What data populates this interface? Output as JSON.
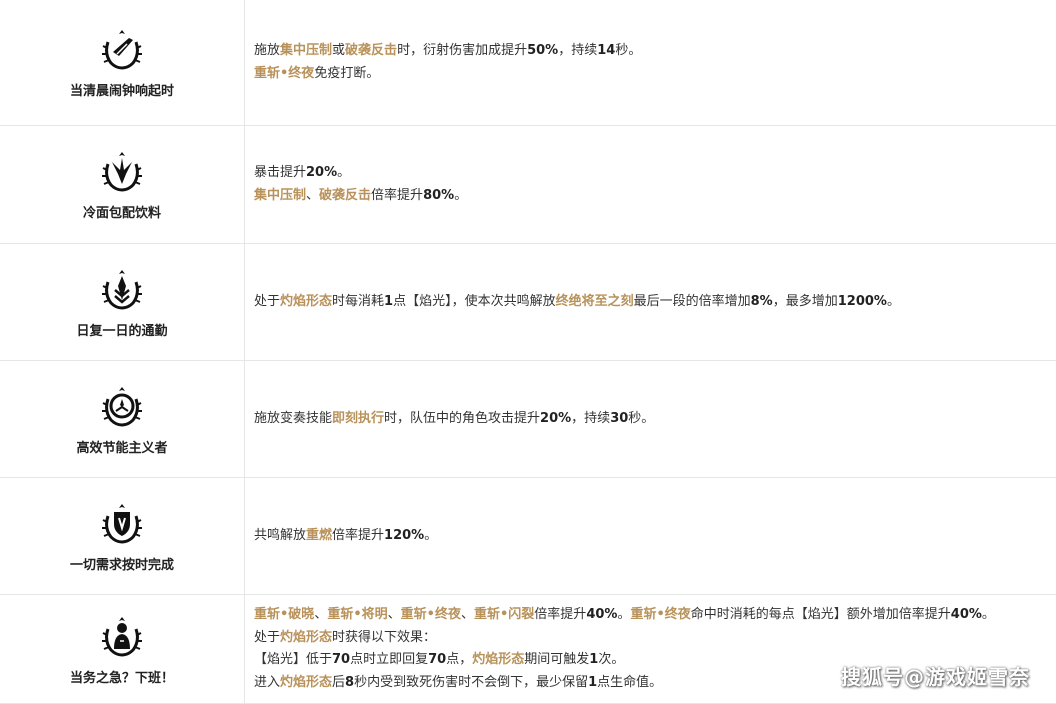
{
  "rows": [
    {
      "name": "当清晨闹钟响起时",
      "lines": [
        [
          [
            "t",
            "施放"
          ],
          [
            "k",
            "集中压制"
          ],
          [
            "t",
            "或"
          ],
          [
            "k",
            "破袭反击"
          ],
          [
            "t",
            "时，衍射伤害加成提升"
          ],
          [
            "n",
            "50%"
          ],
          [
            "t",
            "，持续"
          ],
          [
            "n",
            "14"
          ],
          [
            "t",
            "秒。"
          ]
        ],
        [
          [
            "k",
            "重斩•终夜"
          ],
          [
            "t",
            "免疫打断。"
          ]
        ]
      ]
    },
    {
      "name": "冷面包配饮料",
      "lines": [
        [
          [
            "t",
            "暴击提升"
          ],
          [
            "n",
            "20%"
          ],
          [
            "t",
            "。"
          ]
        ],
        [
          [
            "k",
            "集中压制"
          ],
          [
            "t",
            "、"
          ],
          [
            "k",
            "破袭反击"
          ],
          [
            "t",
            "倍率提升"
          ],
          [
            "n",
            "80%"
          ],
          [
            "t",
            "。"
          ]
        ]
      ]
    },
    {
      "name": "日复一日的通勤",
      "lines": [
        [
          [
            "t",
            "处于"
          ],
          [
            "k",
            "灼焰形态"
          ],
          [
            "t",
            "时每消耗"
          ],
          [
            "n",
            "1"
          ],
          [
            "t",
            "点【焰光】，使本次共鸣解放"
          ],
          [
            "k",
            "终绝将至之刻"
          ],
          [
            "t",
            "最后一段的倍率增加"
          ],
          [
            "n",
            "8%"
          ],
          [
            "t",
            "，最多增加"
          ],
          [
            "n",
            "1200%"
          ],
          [
            "t",
            "。"
          ]
        ]
      ]
    },
    {
      "name": "高效节能主义者",
      "lines": [
        [
          [
            "t",
            "施放变奏技能"
          ],
          [
            "k",
            "即刻执行"
          ],
          [
            "t",
            "时，队伍中的角色攻击提升"
          ],
          [
            "n",
            "20%"
          ],
          [
            "t",
            "，持续"
          ],
          [
            "n",
            "30"
          ],
          [
            "t",
            "秒。"
          ]
        ]
      ]
    },
    {
      "name": "一切需求按时完成",
      "lines": [
        [
          [
            "t",
            "共鸣解放"
          ],
          [
            "k",
            "重燃"
          ],
          [
            "t",
            "倍率提升"
          ],
          [
            "n",
            "120%"
          ],
          [
            "t",
            "。"
          ]
        ]
      ]
    },
    {
      "name": "当务之急？下班！",
      "lines": [
        [
          [
            "k",
            "重斩•破晓"
          ],
          [
            "t",
            "、"
          ],
          [
            "k",
            "重斩•将明"
          ],
          [
            "t",
            "、"
          ],
          [
            "k",
            "重斩•终夜"
          ],
          [
            "t",
            "、"
          ],
          [
            "k",
            "重斩•闪裂"
          ],
          [
            "t",
            "倍率提升"
          ],
          [
            "n",
            "40%"
          ],
          [
            "t",
            "。"
          ],
          [
            "k",
            "重斩•终夜"
          ],
          [
            "t",
            "命中时消耗的每点【焰光】额外增加倍率提升"
          ],
          [
            "n",
            "40%"
          ],
          [
            "t",
            "。"
          ]
        ],
        [
          [
            "t",
            "处于"
          ],
          [
            "k",
            "灼焰形态"
          ],
          [
            "t",
            "时获得以下效果："
          ]
        ],
        [
          [
            "t",
            "【焰光】低于"
          ],
          [
            "n",
            "70"
          ],
          [
            "t",
            "点时立即回复"
          ],
          [
            "n",
            "70"
          ],
          [
            "t",
            "点，"
          ],
          [
            "k",
            "灼焰形态"
          ],
          [
            "t",
            "期间可触发"
          ],
          [
            "n",
            "1"
          ],
          [
            "t",
            "次。"
          ]
        ],
        [
          [
            "t",
            "进入"
          ],
          [
            "k",
            "灼焰形态"
          ],
          [
            "t",
            "后"
          ],
          [
            "n",
            "8"
          ],
          [
            "t",
            "秒内受到致死伤害时不会倒下，最少保留"
          ],
          [
            "n",
            "1"
          ],
          [
            "t",
            "点生命值。"
          ]
        ]
      ]
    }
  ],
  "watermark": "搜狐号@游戏姬雪奈",
  "colors": {
    "keyword": "#b8925a",
    "border": "#e6e6e6"
  }
}
